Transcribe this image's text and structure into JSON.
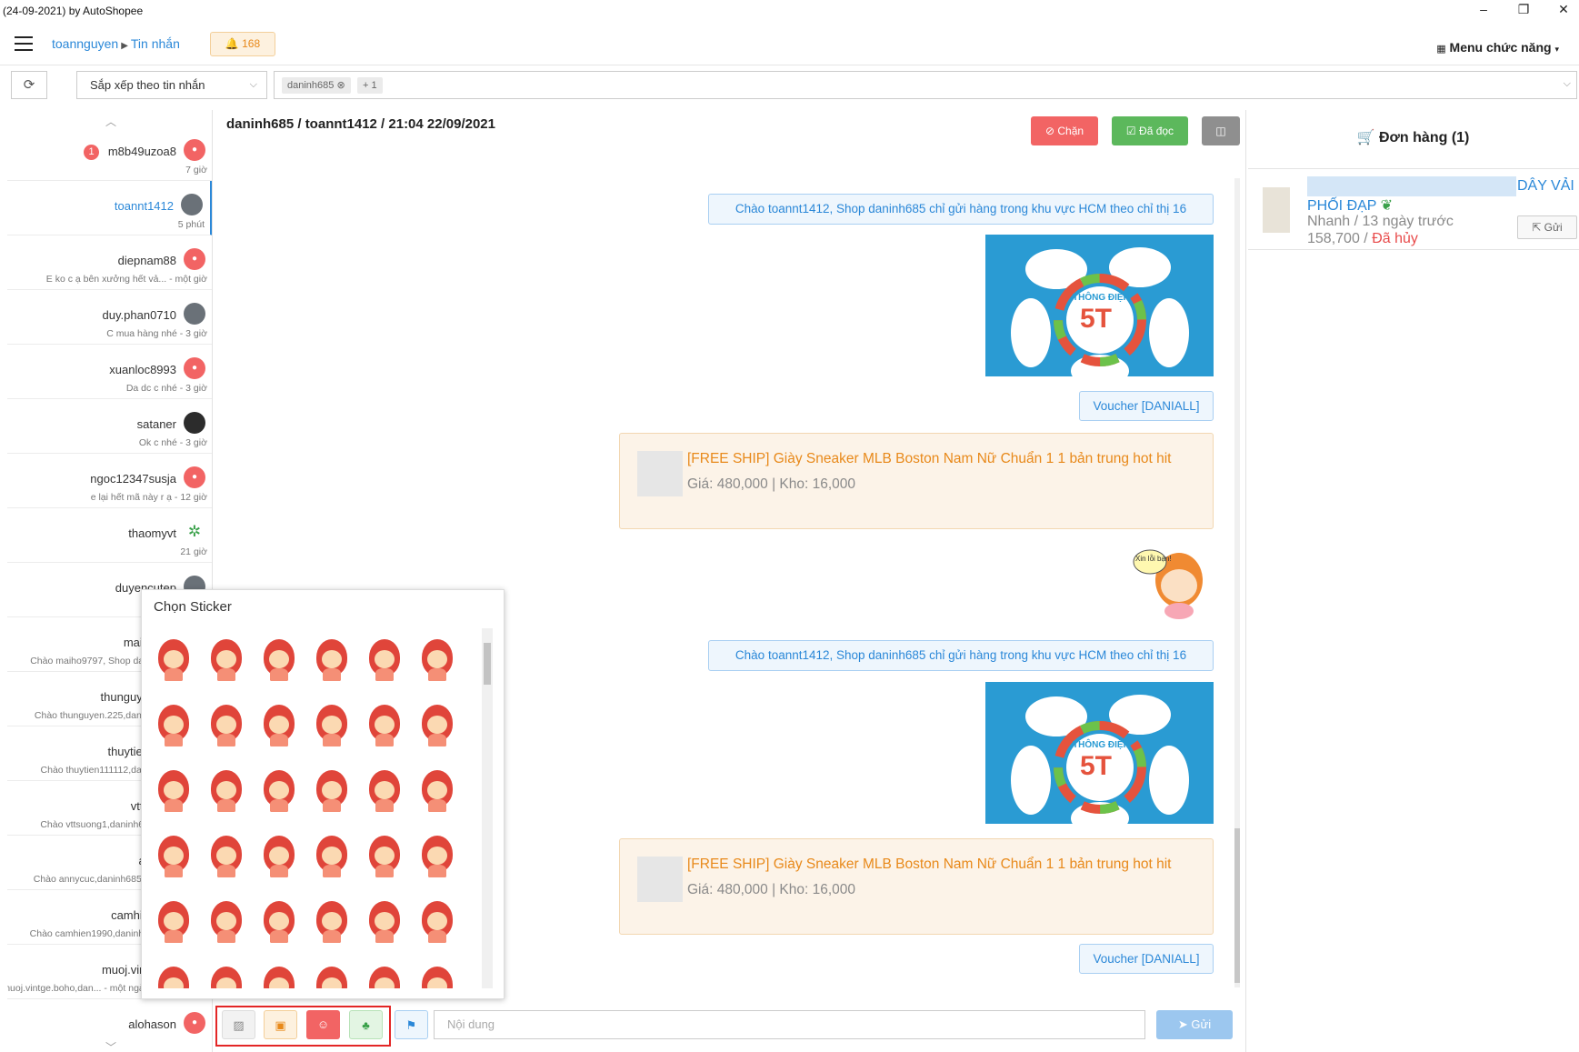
{
  "window": {
    "title": "(24-09-2021) by AutoShopee",
    "minimize": "–",
    "restore": "❐",
    "close": "✕"
  },
  "header": {
    "breadcrumb": [
      "toannguyen",
      "Tin nhắn"
    ],
    "notification_count": "168",
    "menu_label": "Menu chức năng"
  },
  "toolbar": {
    "sort_label": "Sắp xếp theo tin nhắn",
    "tags": [
      "daninh685",
      "+ 1"
    ]
  },
  "conversations": [
    {
      "name": "m8b49uzoa8",
      "meta": "7 giờ",
      "unread": "1",
      "avatar": "user-icon"
    },
    {
      "name": "toannt1412",
      "meta": "5 phút",
      "active": true,
      "avatar": "photo"
    },
    {
      "name": "diepnam88",
      "meta": "E ko c ạ bên xưởng hết vả... - một giờ",
      "avatar": "user-icon"
    },
    {
      "name": "duy.phan0710",
      "meta": "C mua hàng nhé - 3 giờ",
      "avatar": "photo"
    },
    {
      "name": "xuanloc8993",
      "meta": "Da dc c nhé - 3 giờ",
      "avatar": "user-icon"
    },
    {
      "name": "sataner",
      "meta": "Ok c nhé - 3 giờ",
      "avatar": "photo"
    },
    {
      "name": "ngoc12347susja",
      "meta": "e lại hết mã này r ạ - 12 giờ",
      "avatar": "user-icon"
    },
    {
      "name": "thaomyvt",
      "meta": "21 giờ",
      "avatar": "leaf"
    },
    {
      "name": "duyencutep",
      "meta": "",
      "avatar": "photo"
    },
    {
      "name": "maih",
      "meta": "Chào maiho9797, Shop dan",
      "avatar": ""
    },
    {
      "name": "thunguye",
      "meta": "Chào thunguyen.225,danin",
      "avatar": ""
    },
    {
      "name": "thuytien",
      "meta": "Chào thuytien111112,dani",
      "avatar": ""
    },
    {
      "name": "vtts",
      "meta": "Chào vttsuong1,daninh68",
      "avatar": ""
    },
    {
      "name": "ar",
      "meta": "Chào annycuc,daninh685 c",
      "avatar": ""
    },
    {
      "name": "camhie",
      "meta": "Chào camhien1990,daninh6",
      "avatar": ""
    },
    {
      "name": "muoj.vint",
      "meta": "Chào muoj.vintge.boho,dan... - một ngày",
      "avatar": ""
    },
    {
      "name": "alohason",
      "meta": "",
      "avatar": "user-icon"
    }
  ],
  "chat": {
    "header": "daninh685 / toannt1412 / 21:04 22/09/2021",
    "block_label": "Chặn",
    "read_label": "Đã đọc",
    "messages": [
      {
        "type": "text",
        "text": "Chào toannt1412, Shop daninh685 chỉ gửi hàng trong khu vực HCM theo chỉ thị 16"
      },
      {
        "type": "image",
        "label": "THÔNG ĐIỆP",
        "big": "5T"
      },
      {
        "type": "text",
        "text": "Voucher [DANIALL]"
      },
      {
        "type": "product",
        "title": "[FREE SHIP] Giày Sneaker MLB Boston Nam Nữ Chuẩn 1 1 bản trung hot hit",
        "price": "Giá: 480,000 | Kho: 16,000"
      },
      {
        "type": "sticker",
        "text": "Xin lỗi bạn!"
      },
      {
        "type": "text",
        "text": "Chào toannt1412, Shop daninh685 chỉ gửi hàng trong khu vực HCM theo chỉ thị 16"
      },
      {
        "type": "image",
        "label": "THÔNG ĐIỆP",
        "big": "5T"
      },
      {
        "type": "product",
        "title": "[FREE SHIP] Giày Sneaker MLB Boston Nam Nữ Chuẩn 1 1 bản trung hot hit",
        "price": "Giá: 480,000 | Kho: 16,000"
      },
      {
        "type": "text",
        "text": "Voucher [DANIALL]"
      }
    ],
    "input_placeholder": "Nội dung",
    "send_label": "Gửi"
  },
  "sticker_picker": {
    "title": "Chọn Sticker"
  },
  "orders": {
    "title": "Đơn hàng (1)",
    "items": [
      {
        "name_tail": "DÂY VẢI",
        "name_line2": "PHỐI ĐẠP",
        "shipping": "Nhanh / 13 ngày trước",
        "price": "158,700",
        "status": "Đã hủy",
        "send_label": "Gửi"
      }
    ]
  },
  "colors": {
    "accent": "#2b88d8",
    "danger": "#f26464",
    "success": "#5cb85c",
    "product_title": "#e8891a"
  }
}
